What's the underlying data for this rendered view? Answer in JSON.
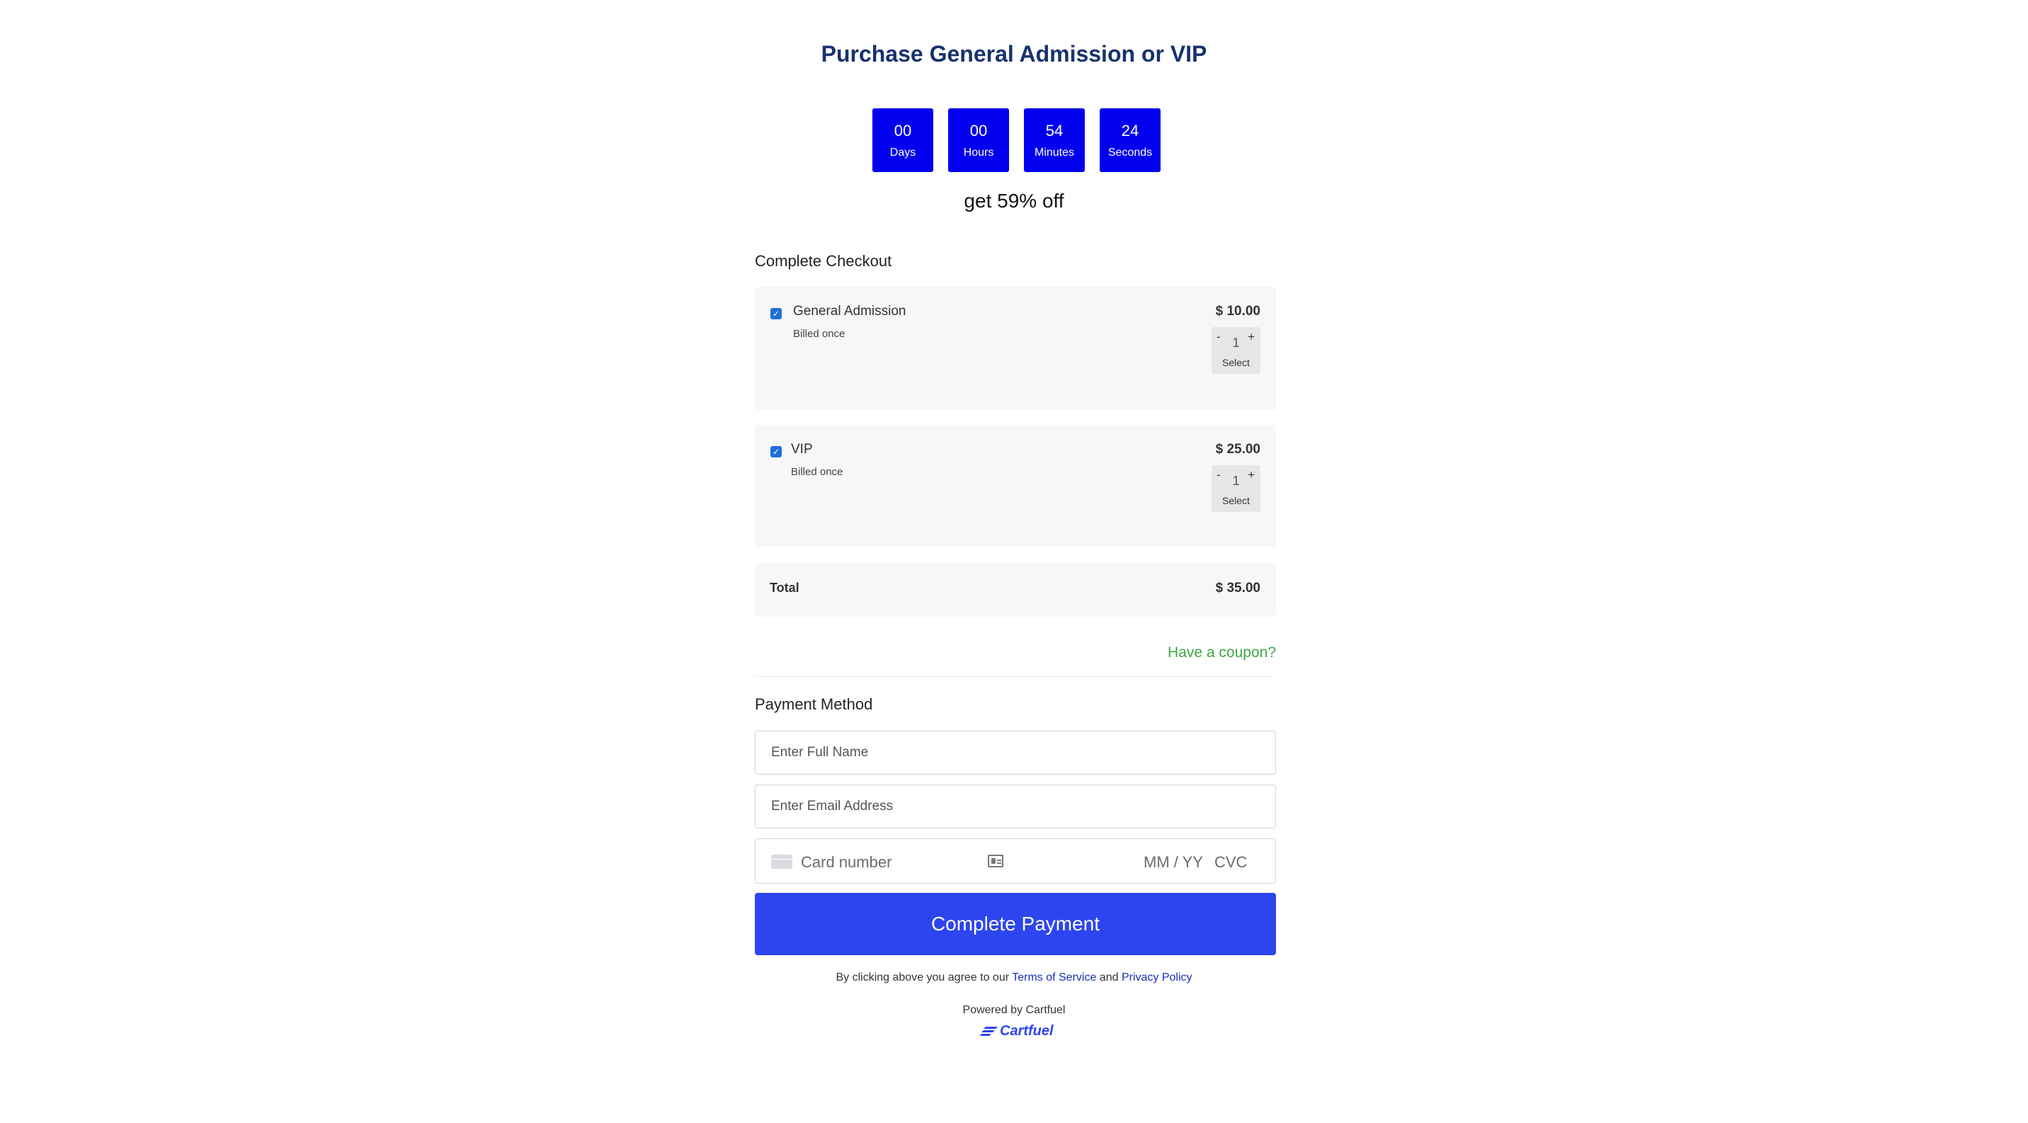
{
  "header": {
    "title": "Purchase General Admission or VIP",
    "discount_text": "get 59% off"
  },
  "countdown": [
    {
      "value": "00",
      "label": "Days"
    },
    {
      "value": "00",
      "label": "Hours"
    },
    {
      "value": "54",
      "label": "Minutes"
    },
    {
      "value": "24",
      "label": "Seconds"
    }
  ],
  "checkout": {
    "heading": "Complete Checkout",
    "items": [
      {
        "name": "General Admission",
        "billing": "Billed once",
        "price": "$ 10.00",
        "checked": true,
        "quantity": "1",
        "minus": "-",
        "plus": "+",
        "select_label": "Select"
      },
      {
        "name": "VIP",
        "billing": "Billed once",
        "price": "$ 25.00",
        "checked": true,
        "quantity": "1",
        "minus": "-",
        "plus": "+",
        "select_label": "Select"
      }
    ],
    "total_label": "Total",
    "total_value": "$ 35.00",
    "coupon_link": "Have a coupon?"
  },
  "payment": {
    "heading": "Payment Method",
    "name_placeholder": "Enter Full Name",
    "email_placeholder": "Enter Email Address",
    "card_number_placeholder": "Card number",
    "card_expiry_placeholder": "MM / YY",
    "card_cvc_placeholder": "CVC",
    "submit_label": "Complete Payment"
  },
  "footer": {
    "agree_prefix": "By clicking above you agree to our ",
    "terms_link": "Terms of Service",
    "and_text": " and ",
    "privacy_link": "Privacy Policy",
    "powered_by": "Powered by Cartfuel",
    "brand_name": "Cartfuel"
  },
  "colors": {
    "title": "#17326e",
    "countdown_bg": "#0000ee",
    "button_bg": "#2d45ee",
    "coupon": "#3fa644",
    "link": "#1a2fb8",
    "card_bg": "#f7f7f8",
    "checkbox": "#1f6fd6"
  },
  "icons": {
    "checkbox": "check-icon",
    "card": "credit-card-icon",
    "card_autofill": "id-card-icon",
    "brand": "cartfuel-logo-icon"
  }
}
